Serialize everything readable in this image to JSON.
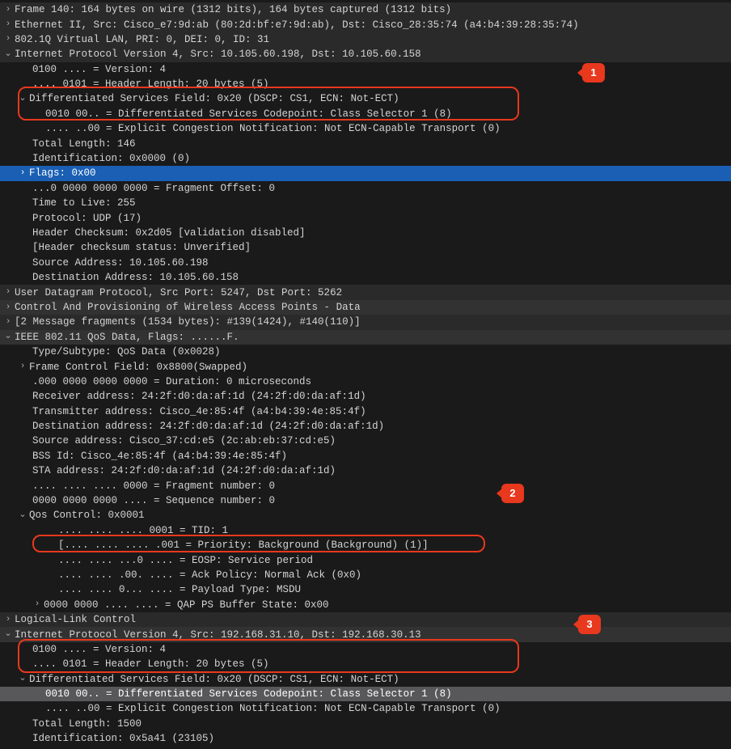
{
  "lines": {
    "frame": "Frame 140: 164 bytes on wire (1312 bits), 164 bytes captured (1312 bits)",
    "eth": "Ethernet II, Src: Cisco_e7:9d:ab (80:2d:bf:e7:9d:ab), Dst: Cisco_28:35:74 (a4:b4:39:28:35:74)",
    "vlan": "802.1Q Virtual LAN, PRI: 0, DEI: 0, ID: 31",
    "ipv4a": "Internet Protocol Version 4, Src: 10.105.60.198, Dst: 10.105.60.158",
    "ver_a": "0100 .... = Version: 4",
    "hlen_a": ".... 0101 = Header Length: 20 bytes (5)",
    "dscp_a": "Differentiated Services Field: 0x20 (DSCP: CS1, ECN: Not-ECT)",
    "dscp_cp_a": "0010 00.. = Differentiated Services Codepoint: Class Selector 1 (8)",
    "ecn_a": ".... ..00 = Explicit Congestion Notification: Not ECN-Capable Transport (0)",
    "tlen_a": "Total Length: 146",
    "ident_a": "Identification: 0x0000 (0)",
    "flags_a": "Flags: 0x00",
    "fragoff": "...0 0000 0000 0000 = Fragment Offset: 0",
    "ttl": "Time to Live: 255",
    "proto": "Protocol: UDP (17)",
    "checksum": "Header Checksum: 0x2d05 [validation disabled]",
    "checksum_stat": "[Header checksum status: Unverified]",
    "srcaddr": "Source Address: 10.105.60.198",
    "dstaddr": "Destination Address: 10.105.60.158",
    "udp": "User Datagram Protocol, Src Port: 5247, Dst Port: 5262",
    "capwap": "Control And Provisioning of Wireless Access Points - Data",
    "reassembly": "[2 Message fragments (1534 bytes): #139(1424), #140(110)]",
    "ieee": "IEEE 802.11 QoS Data, Flags: ......F.",
    "typesubtype": "Type/Subtype: QoS Data (0x0028)",
    "framectl": "Frame Control Field: 0x8800(Swapped)",
    "duration": ".000 0000 0000 0000 = Duration: 0 microseconds",
    "rxaddr": "Receiver address: 24:2f:d0:da:af:1d (24:2f:d0:da:af:1d)",
    "txaddr": "Transmitter address: Cisco_4e:85:4f (a4:b4:39:4e:85:4f)",
    "destaddr": "Destination address: 24:2f:d0:da:af:1d (24:2f:d0:da:af:1d)",
    "srcaddr2": "Source address: Cisco_37:cd:e5 (2c:ab:eb:37:cd:e5)",
    "bssid": "BSS Id: Cisco_4e:85:4f (a4:b4:39:4e:85:4f)",
    "staaddr": "STA address: 24:2f:d0:da:af:1d (24:2f:d0:da:af:1d)",
    "fragnum": ".... .... .... 0000 = Fragment number: 0",
    "seqnum": "0000 0000 0000 .... = Sequence number: 0",
    "qosctl": "Qos Control: 0x0001",
    "tid": ".... .... .... 0001 = TID: 1",
    "priority": "[.... .... .... .001 = Priority: Background (Background) (1)]",
    "eosp": ".... .... ...0 .... = EOSP: Service period",
    "ackpol": ".... .... .00. .... = Ack Policy: Normal Ack (0x0)",
    "payload": ".... .... 0... .... = Payload Type: MSDU",
    "qapps": "0000 0000 .... .... = QAP PS Buffer State: 0x00",
    "llc": "Logical-Link Control",
    "ipv4b": "Internet Protocol Version 4, Src: 192.168.31.10, Dst: 192.168.30.13",
    "ver_b": "0100 .... = Version: 4",
    "hlen_b": ".... 0101 = Header Length: 20 bytes (5)",
    "dscp_b": "Differentiated Services Field: 0x20 (DSCP: CS1, ECN: Not-ECT)",
    "dscp_cp_b": "0010 00.. = Differentiated Services Codepoint: Class Selector 1 (8)",
    "ecn_b": ".... ..00 = Explicit Congestion Notification: Not ECN-Capable Transport (0)",
    "tlen_b": "Total Length: 1500",
    "ident_b": "Identification: 0x5a41 (23105)"
  },
  "callouts": {
    "c1": "1",
    "c2": "2",
    "c3": "3"
  }
}
